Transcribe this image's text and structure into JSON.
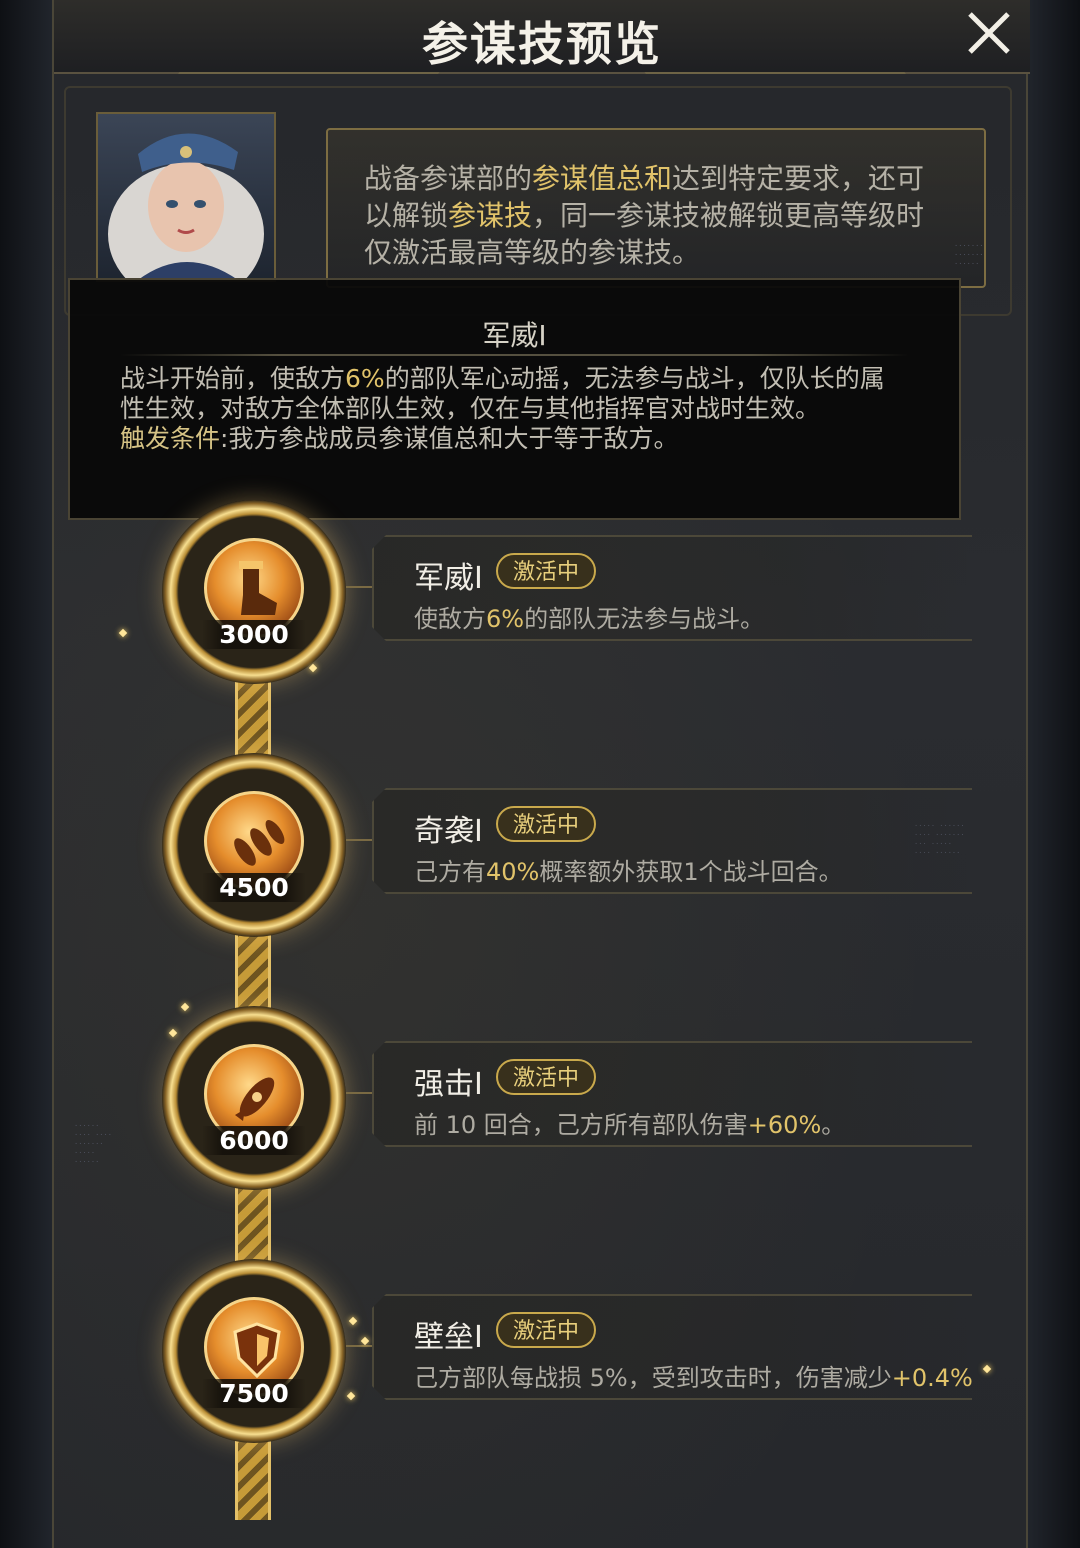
{
  "header": {
    "title": "参谋技预览"
  },
  "intro": {
    "text_before": "战备参谋部的",
    "highlight": "参谋值总和",
    "text_mid": "达到特定要求，还可以解锁",
    "highlight2": "参谋技",
    "text_after": "，同一参谋技被解锁更高等级时仅激活最高等级的参谋技。"
  },
  "tooltip": {
    "title": "军威I",
    "body_before": "战斗开始前，使敌方",
    "body_value": "6%",
    "body_after": "的部队军心动摇，无法参与战斗，仅队长的属性生效，对敌方全体部队生效，仅在与其他指挥官对战时生效。",
    "condition_label": "触发条件",
    "condition_text": ":我方参战成员参谋值总和大于等于敌方。"
  },
  "skills": [
    {
      "score": "3000",
      "name": "军威I",
      "status": "激活中",
      "desc_before": "使敌方",
      "desc_value": "6%",
      "desc_after": "的部队无法参与战斗。",
      "icon": "boot-kick-icon"
    },
    {
      "score": "4500",
      "name": "奇袭I",
      "status": "激活中",
      "desc_before": "己方有",
      "desc_value": "40%",
      "desc_after": "概率额外获取1个战斗回合。",
      "icon": "bullets-icon"
    },
    {
      "score": "6000",
      "name": "强击I",
      "status": "激活中",
      "desc_before": "前 10 回合，己方所有部队伤害",
      "desc_value": "+60%",
      "desc_after": "。",
      "icon": "missile-icon"
    },
    {
      "score": "7500",
      "name": "壁垒I",
      "status": "激活中",
      "desc_before": "己方部队每战损 5%，受到攻击时，伤害减少",
      "desc_value": "+0.4%",
      "desc_after": "。",
      "icon": "shield-icon"
    }
  ]
}
